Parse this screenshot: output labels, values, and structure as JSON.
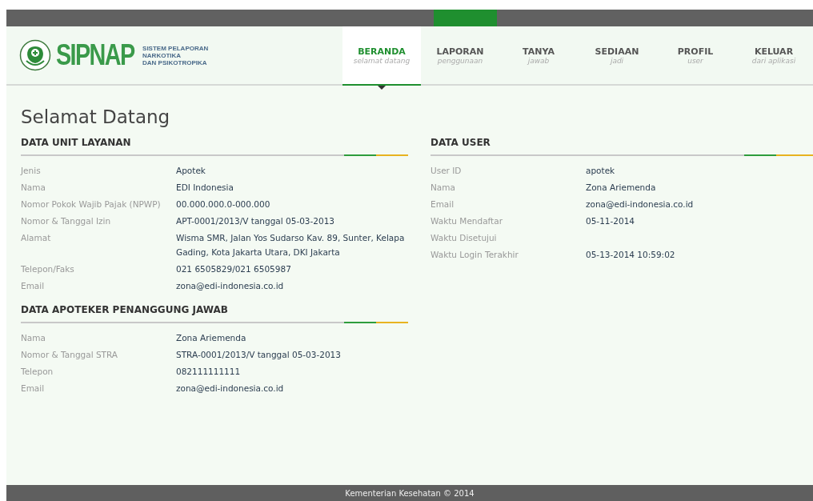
{
  "logo": {
    "name": "SIPNAP",
    "tagline": [
      "SISTEM PELAPORAN",
      "NARKOTIKA",
      "DAN PSIKOTROPIKA"
    ]
  },
  "nav": [
    {
      "label": "BERANDA",
      "sub": "selamat datang",
      "selected": true
    },
    {
      "label": "LAPORAN",
      "sub": "penggunaan",
      "selected": false
    },
    {
      "label": "TANYA",
      "sub": "jawab",
      "selected": false
    },
    {
      "label": "SEDIAAN",
      "sub": "jadi",
      "selected": false
    },
    {
      "label": "PROFIL",
      "sub": "user",
      "selected": false
    },
    {
      "label": "KELUAR",
      "sub": "dari aplikasi",
      "selected": false
    }
  ],
  "page_title": "Selamat Datang",
  "left_sections": [
    {
      "title": "DATA UNIT LAYANAN",
      "rows": [
        {
          "label": "Jenis",
          "value": "Apotek"
        },
        {
          "label": "Nama",
          "value": "EDI Indonesia"
        },
        {
          "label": "Nomor Pokok Wajib Pajak (NPWP)",
          "value": "00.000.000.0-000.000"
        },
        {
          "label": "Nomor & Tanggal Izin",
          "value": "APT-0001/2013/V tanggal 05-03-2013"
        },
        {
          "label": "Alamat",
          "value": "Wisma SMR, Jalan Yos Sudarso Kav. 89, Sunter, Kelapa Gading, Kota Jakarta Utara, DKI Jakarta"
        },
        {
          "label": "Telepon/Faks",
          "value": "021 6505829/021 6505987"
        },
        {
          "label": "Email",
          "value": "zona@edi-indonesia.co.id"
        }
      ]
    },
    {
      "title": "DATA APOTEKER PENANGGUNG JAWAB",
      "rows": [
        {
          "label": "Nama",
          "value": "Zona Ariemenda"
        },
        {
          "label": "Nomor & Tanggal STRA",
          "value": "STRA-0001/2013/V tanggal 05-03-2013"
        },
        {
          "label": "Telepon",
          "value": "082111111111"
        },
        {
          "label": "Email",
          "value": "zona@edi-indonesia.co.id"
        }
      ]
    }
  ],
  "right_sections": [
    {
      "title": "DATA USER",
      "rows": [
        {
          "label": "User ID",
          "value": "apotek"
        },
        {
          "label": "Nama",
          "value": "Zona Ariemenda"
        },
        {
          "label": "Email",
          "value": "zona@edi-indonesia.co.id"
        },
        {
          "label": "Waktu Mendaftar",
          "value": "05-11-2014"
        },
        {
          "label": "Waktu Disetujui"
        },
        {
          "label": "Waktu Login Terakhir",
          "value": "05-13-2014 10:59:02"
        }
      ]
    }
  ],
  "footer": "Kementerian Kesehatan © 2014"
}
